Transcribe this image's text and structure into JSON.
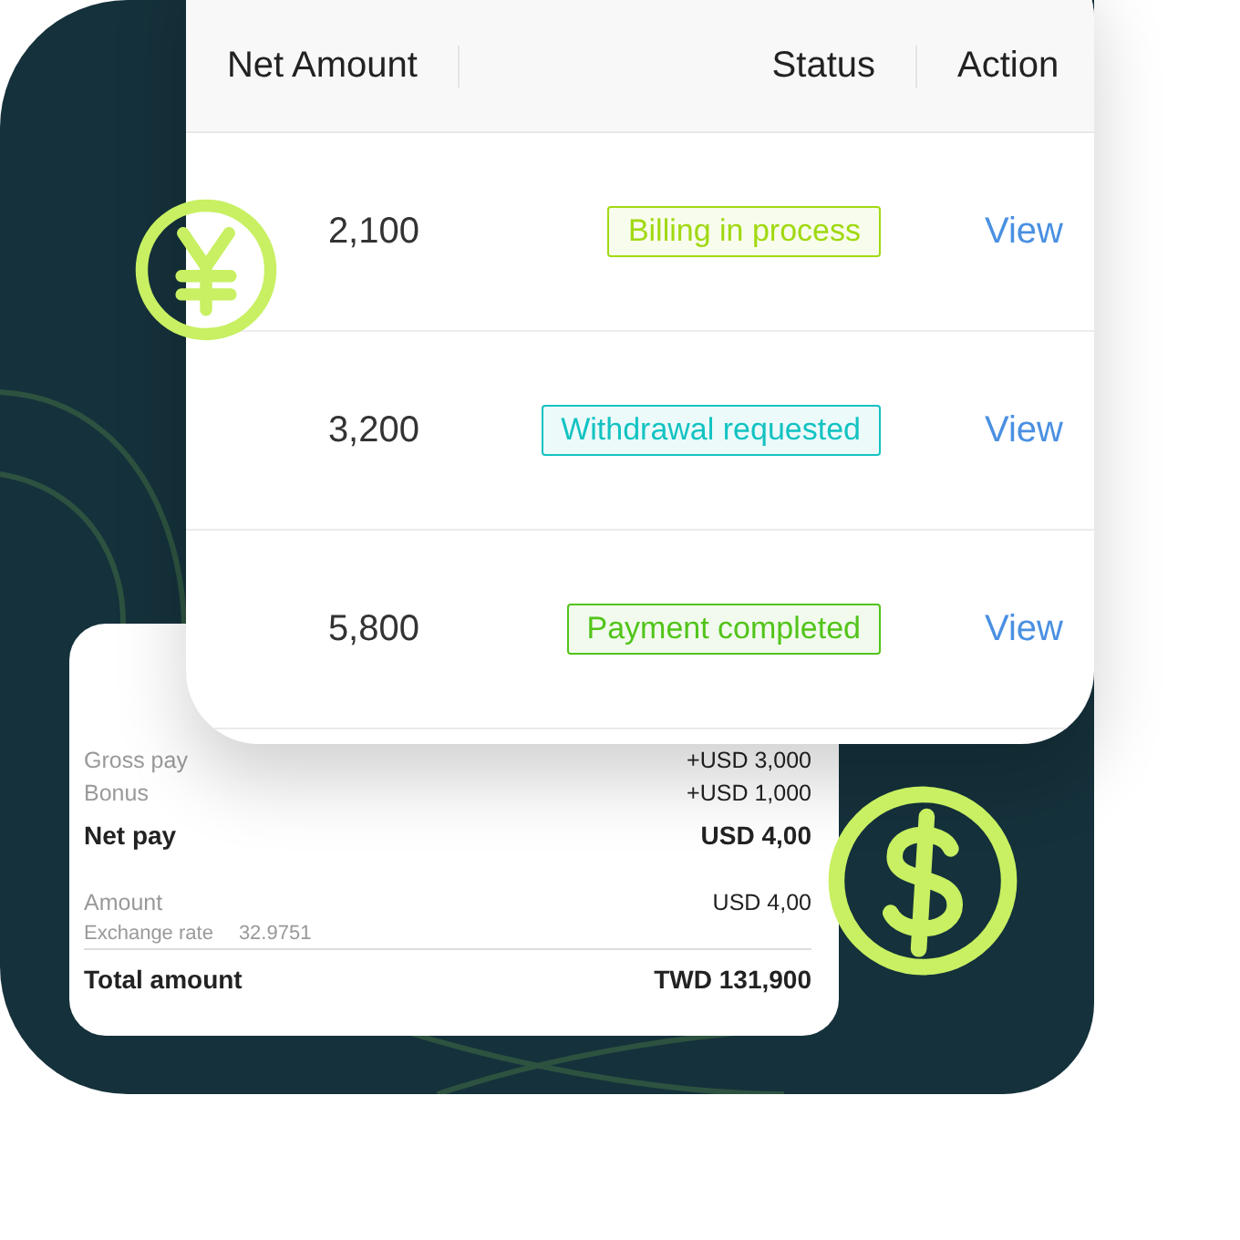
{
  "table": {
    "columns": [
      "Net Amount",
      "Status",
      "Action"
    ],
    "rows": [
      {
        "net_amount": "2,100",
        "status": {
          "label": "Billing in process",
          "color": "#a0d911"
        },
        "action": "View"
      },
      {
        "net_amount": "3,200",
        "status": {
          "label": "Withdrawal requested",
          "color": "#13c2c2"
        },
        "action": "View"
      },
      {
        "net_amount": "5,800",
        "status": {
          "label": "Payment completed",
          "color": "#52c41a"
        },
        "action": "View"
      }
    ]
  },
  "summary": {
    "lines": [
      {
        "kind": "item",
        "label": "Gross pay",
        "value": "+USD 3,000"
      },
      {
        "kind": "item",
        "label": "Bonus",
        "value": "+USD 1,000"
      },
      {
        "kind": "subtotal",
        "label": "Net pay",
        "value": "USD 4,00"
      },
      {
        "kind": "item",
        "label": "Amount",
        "value": "USD 4,00"
      },
      {
        "kind": "note",
        "label": "Exchange rate",
        "value": "32.9751"
      },
      {
        "kind": "total",
        "label": "Total amount",
        "value": "TWD 131,900"
      }
    ]
  }
}
